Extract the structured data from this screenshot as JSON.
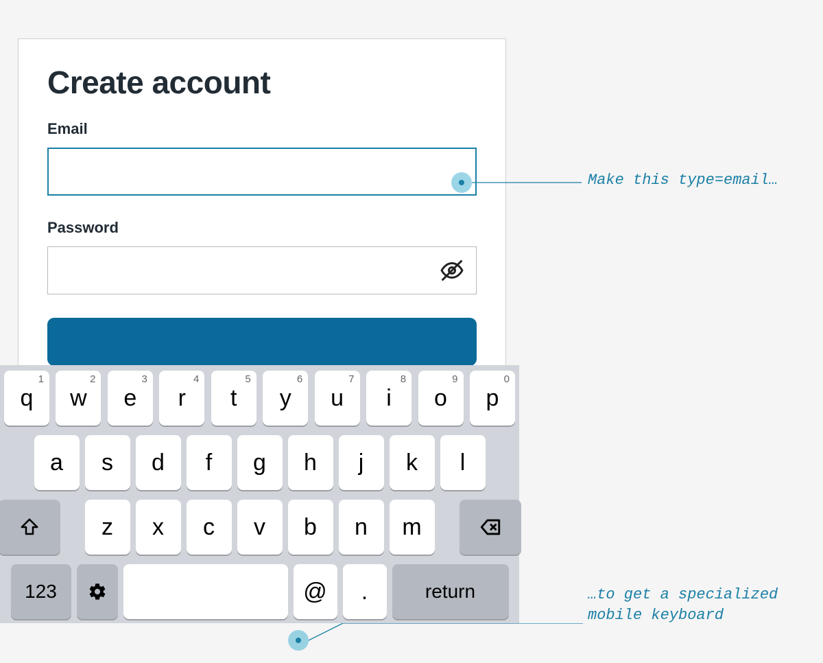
{
  "form": {
    "title": "Create account",
    "email_label": "Email",
    "email_value": "",
    "password_label": "Password",
    "password_value": ""
  },
  "keyboard": {
    "row1": [
      {
        "main": "q",
        "sup": "1"
      },
      {
        "main": "w",
        "sup": "2"
      },
      {
        "main": "e",
        "sup": "3"
      },
      {
        "main": "r",
        "sup": "4"
      },
      {
        "main": "t",
        "sup": "5"
      },
      {
        "main": "y",
        "sup": "6"
      },
      {
        "main": "u",
        "sup": "7"
      },
      {
        "main": "i",
        "sup": "8"
      },
      {
        "main": "o",
        "sup": "9"
      },
      {
        "main": "p",
        "sup": "0"
      }
    ],
    "row2": [
      "a",
      "s",
      "d",
      "f",
      "g",
      "h",
      "j",
      "k",
      "l"
    ],
    "row3": [
      "z",
      "x",
      "c",
      "v",
      "b",
      "n",
      "m"
    ],
    "mode_label": "123",
    "at_label": "@",
    "dot_label": ".",
    "return_label": "return"
  },
  "annotations": {
    "a1": "Make this type=email…",
    "a2": "…to get a specialized mobile keyboard"
  },
  "colors": {
    "accent": "#1b7fa6",
    "submit_bg": "#0b6a99"
  }
}
